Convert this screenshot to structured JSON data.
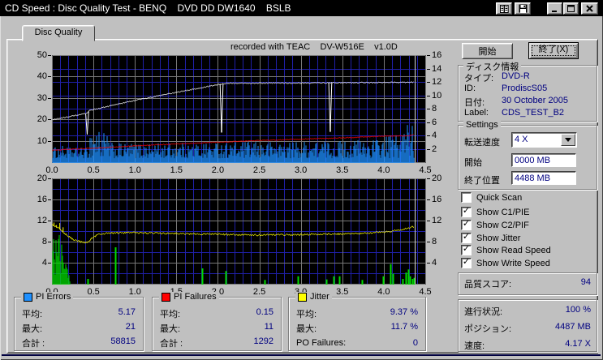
{
  "window": {
    "title": "CD Speed : Disc Quality Test - BENQ    DVD DD DW1640    BSLB"
  },
  "tab": {
    "label": "Disc Quality"
  },
  "overlay_note": "recorded with TEAC    DV-W516E    v1.0D",
  "chart_data": [
    {
      "type": "bar",
      "name": "pi-errors-and-speed-chart",
      "x_range": [
        0,
        4.5
      ],
      "x_ticks": [
        "0.0",
        "0.5",
        "1.0",
        "1.5",
        "2.0",
        "2.5",
        "3.0",
        "3.5",
        "4.0",
        "4.5"
      ],
      "left_axis": {
        "range": [
          0,
          50
        ],
        "ticks": [
          50,
          40,
          30,
          20,
          10
        ]
      },
      "right_axis": {
        "range": [
          0,
          16
        ],
        "ticks": [
          16,
          14,
          12,
          10,
          8,
          6,
          4,
          2
        ]
      },
      "grid": {
        "bg": "#000000",
        "minor": "#2020A8",
        "major": "#787878"
      },
      "cursor_x": 4.37,
      "data_end_x": 4.36,
      "series": [
        {
          "name": "PI Errors",
          "kind": "bars",
          "axis": "left",
          "color": "#1E90FF",
          "floor": 2,
          "envelope": [
            [
              0,
              7
            ],
            [
              0.1,
              8
            ],
            [
              0.2,
              7
            ],
            [
              0.42,
              7
            ],
            [
              0.45,
              15
            ],
            [
              0.5,
              18
            ],
            [
              0.58,
              17
            ],
            [
              0.65,
              13
            ],
            [
              0.72,
              9
            ],
            [
              1.0,
              9
            ],
            [
              2.0,
              9.5
            ],
            [
              3.0,
              10
            ],
            [
              3.6,
              10.5
            ],
            [
              4.0,
              12
            ],
            [
              4.15,
              14
            ],
            [
              4.25,
              18
            ],
            [
              4.32,
              22
            ],
            [
              4.36,
              22
            ]
          ]
        },
        {
          "name": "Write Speed",
          "kind": "line",
          "axis": "right",
          "color": "#FFFFFF",
          "noise": 0.07,
          "points": [
            [
              0,
              6.4
            ],
            [
              0.42,
              7.35
            ],
            [
              0.45,
              7.8
            ],
            [
              1.0,
              9.3
            ],
            [
              1.5,
              10.5
            ],
            [
              2.02,
              11.7
            ],
            [
              2.1,
              11.85
            ],
            [
              3.0,
              11.9
            ],
            [
              4.36,
              12.0
            ]
          ],
          "dips": [
            [
              0.42,
              4.2
            ],
            [
              2.04,
              4.5
            ],
            [
              3.35,
              4.6
            ]
          ]
        },
        {
          "name": "Read Speed",
          "kind": "line",
          "axis": "right",
          "color": "#FF0000",
          "noise": 0.05,
          "points": [
            [
              0,
              1.85
            ],
            [
              0.5,
              2.15
            ],
            [
              1.0,
              2.5
            ],
            [
              1.5,
              2.8
            ],
            [
              2.0,
              3.05
            ],
            [
              2.5,
              3.3
            ],
            [
              3.0,
              3.5
            ],
            [
              3.5,
              3.7
            ],
            [
              4.0,
              3.95
            ],
            [
              4.3,
              4.0
            ],
            [
              4.36,
              4.2
            ]
          ]
        }
      ]
    },
    {
      "type": "bar",
      "name": "pi-failures-and-jitter-chart",
      "x_range": [
        0,
        4.5
      ],
      "x_ticks": [
        "0.0",
        "0.5",
        "1.0",
        "1.5",
        "2.0",
        "2.5",
        "3.0",
        "3.5",
        "4.0",
        "4.5"
      ],
      "left_axis": {
        "range": [
          0,
          20
        ],
        "ticks": [
          20,
          16,
          12,
          8,
          4
        ]
      },
      "right_axis": {
        "range": [
          0,
          20
        ],
        "ticks": [
          20,
          16,
          12,
          8,
          4
        ]
      },
      "grid": {
        "bg": "#000000",
        "minor": "#2020A8",
        "major": "#787878"
      },
      "cursor_x": 4.37,
      "data_end_x": 4.36,
      "series": [
        {
          "name": "PI Failures",
          "kind": "bars",
          "axis": "left",
          "color": "#00DC00",
          "floor": 0,
          "cluster_envelope": [
            [
              0,
              11
            ],
            [
              0.03,
              12
            ],
            [
              0.06,
              10
            ],
            [
              0.1,
              9
            ],
            [
              0.14,
              6
            ],
            [
              0.18,
              3
            ],
            [
              0.21,
              1
            ],
            [
              0.22,
              0
            ]
          ],
          "spikes": [
            [
              0.42,
              1
            ],
            [
              0.75,
              7
            ],
            [
              1.8,
              3
            ],
            [
              2.08,
              2.5
            ],
            [
              2.55,
              0.8
            ],
            [
              2.95,
              1.5
            ],
            [
              3.3,
              0.9
            ],
            [
              3.38,
              1.5
            ],
            [
              3.45,
              1.5
            ],
            [
              3.73,
              0.8
            ],
            [
              3.98,
              1.5
            ],
            [
              4.07,
              3.8
            ],
            [
              4.1,
              2
            ],
            [
              4.22,
              1
            ],
            [
              4.26,
              2.2
            ],
            [
              4.28,
              2.8
            ],
            [
              4.3,
              1.5
            ],
            [
              4.33,
              1
            ],
            [
              4.35,
              1.2
            ]
          ]
        },
        {
          "name": "Jitter",
          "kind": "line",
          "axis": "left",
          "color": "#FFFF00",
          "noise": 0.16,
          "points": [
            [
              0,
              11.3
            ],
            [
              0.08,
              10.6
            ],
            [
              0.15,
              9.6
            ],
            [
              0.25,
              8.5
            ],
            [
              0.35,
              8.0
            ],
            [
              0.42,
              7.9
            ],
            [
              0.47,
              8.6
            ],
            [
              0.55,
              9.4
            ],
            [
              0.7,
              9.7
            ],
            [
              1.0,
              9.8
            ],
            [
              1.4,
              9.6
            ],
            [
              1.9,
              9.5
            ],
            [
              2.4,
              9.3
            ],
            [
              2.9,
              9.4
            ],
            [
              3.4,
              9.5
            ],
            [
              3.7,
              9.6
            ],
            [
              4.0,
              9.9
            ],
            [
              4.2,
              10.3
            ],
            [
              4.36,
              10.9
            ]
          ],
          "start_spikes": [
            [
              0.02,
              11.7
            ],
            [
              0.05,
              11.2
            ],
            [
              0.09,
              11.6
            ],
            [
              0.13,
              10.8
            ]
          ]
        }
      ]
    }
  ],
  "stats_boxes": [
    {
      "legend": "PI Errors",
      "swatch_color": "#1E90FF",
      "rows": [
        {
          "label": "平均:",
          "value": "5.17"
        },
        {
          "label": "最大:",
          "value": "21"
        },
        {
          "label": "合計 :",
          "value": "58815"
        }
      ]
    },
    {
      "legend": "PI Failures",
      "swatch_color": "#FF0000",
      "rows": [
        {
          "label": "平均:",
          "value": "0.15"
        },
        {
          "label": "最大:",
          "value": "11"
        },
        {
          "label": "合計 :",
          "value": "1292"
        }
      ]
    },
    {
      "legend": "Jitter",
      "swatch_color": "#FFFF00",
      "rows": [
        {
          "label": "平均:",
          "value": "9.37 %"
        },
        {
          "label": "最大:",
          "value": "11.7 %"
        },
        {
          "label": "PO Failures:",
          "value": "0"
        }
      ]
    }
  ],
  "right_panel": {
    "start_button": "開始",
    "exit_button": "終了(X)",
    "disc_info": {
      "legend": "ディスク情報",
      "rows": [
        {
          "label": "タイプ:",
          "value": "DVD-R"
        },
        {
          "label": "ID:",
          "value": "ProdiscS05"
        },
        {
          "label": "日付:",
          "value": "30 October 2005"
        },
        {
          "label": "Label:",
          "value": "CDS_TEST_B2"
        }
      ]
    },
    "settings": {
      "legend": "Settings",
      "speed_label": "転送速度",
      "speed_value": "4 X",
      "start_label": "開始",
      "start_value": "0000 MB",
      "end_label": "終了位置",
      "end_value": "4488 MB"
    },
    "checkboxes": [
      {
        "label": "Quick Scan",
        "checked": false
      },
      {
        "label": "Show C1/PIE",
        "checked": true
      },
      {
        "label": "Show C2/PIF",
        "checked": true
      },
      {
        "label": "Show Jitter",
        "checked": true
      },
      {
        "label": "Show Read Speed",
        "checked": true
      },
      {
        "label": "Show Write Speed",
        "checked": true
      }
    ],
    "score": {
      "label": "品質スコア:",
      "value": "94"
    },
    "progress": {
      "rows": [
        {
          "label": "進行状況:",
          "value": "100 %"
        },
        {
          "label": "ポジション:",
          "value": "4487 MB"
        },
        {
          "label": "速度:",
          "value": "4.17 X"
        }
      ]
    }
  },
  "colors": {
    "titlebar_bg": "#000000",
    "window_bg": "#C0C0C0",
    "value_text": "#000080",
    "chart_bg": "#000000",
    "grid_minor": "#2020A8",
    "grid_major": "#787878",
    "cursor": "#D8D8D8"
  }
}
